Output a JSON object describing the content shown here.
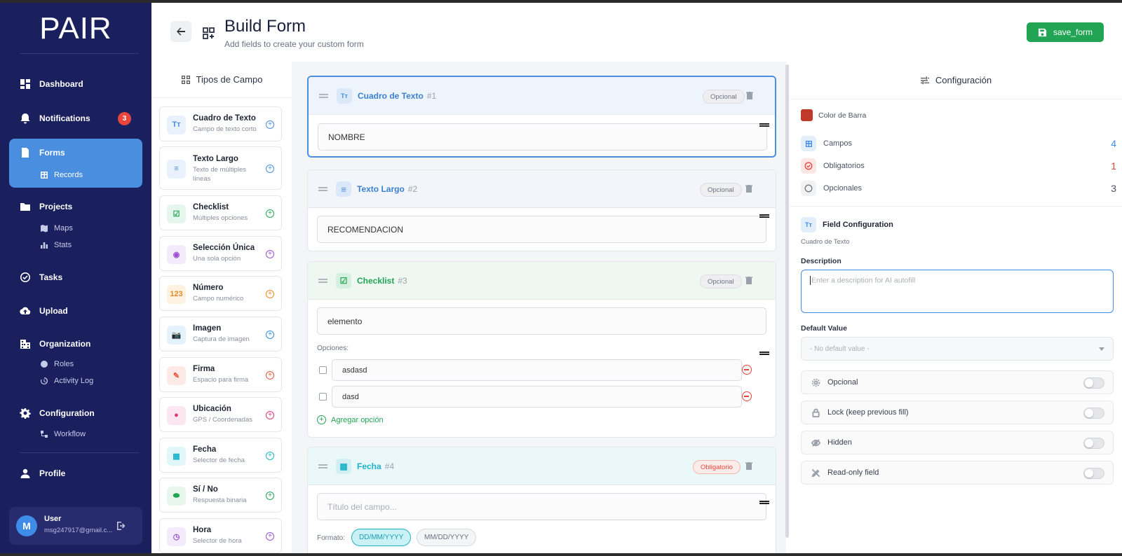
{
  "app": {
    "logo": "PAIR"
  },
  "sidebar": {
    "dashboard": "Dashboard",
    "notifications": "Notifications",
    "notifications_badge": "3",
    "forms": "Forms",
    "records": "Records",
    "projects": "Projects",
    "maps": "Maps",
    "stats": "Stats",
    "tasks": "Tasks",
    "upload": "Upload",
    "organization": "Organization",
    "roles": "Roles",
    "activity_log": "Activity Log",
    "configuration": "Configuration",
    "workflow": "Workflow",
    "profile": "Profile",
    "user": {
      "initial": "M",
      "name": "User",
      "email": "msg247917@gmail.c..."
    }
  },
  "header": {
    "title": "Build Form",
    "subtitle": "Add fields to create your custom form",
    "save_label": "save_form"
  },
  "field_types": {
    "title": "Tipos de Campo",
    "items": [
      {
        "name": "Cuadro de Texto",
        "desc": "Campo de texto corto",
        "icon": "Tт",
        "color": "#4a8ee0",
        "bg": "#e8f1fc"
      },
      {
        "name": "Texto Largo",
        "desc": "Texto de múltiples líneas",
        "icon": "≡",
        "color": "#4a8ee0",
        "bg": "#e8f1fc"
      },
      {
        "name": "Checklist",
        "desc": "Múltiples opciones",
        "icon": "☑",
        "color": "#22a455",
        "bg": "#e6f6ec"
      },
      {
        "name": "Selección Única",
        "desc": "Una sola opción",
        "icon": "◉",
        "color": "#9b4fd0",
        "bg": "#f3eafb"
      },
      {
        "name": "Número",
        "desc": "Campo numérico",
        "icon": "123",
        "color": "#e88a1e",
        "bg": "#fdf1e2"
      },
      {
        "name": "Imagen",
        "desc": "Captura de imagen",
        "icon": "📷",
        "color": "#2a8fd8",
        "bg": "#e4f2fb"
      },
      {
        "name": "Firma",
        "desc": "Espacio para firma",
        "icon": "✎",
        "color": "#e8553c",
        "bg": "#fde9e5"
      },
      {
        "name": "Ubicación",
        "desc": "GPS / Coordenadas",
        "icon": "●",
        "color": "#e0357a",
        "bg": "#fce6ef"
      },
      {
        "name": "Fecha",
        "desc": "Selector de fecha",
        "icon": "▦",
        "color": "#1db3c7",
        "bg": "#e1f6f8"
      },
      {
        "name": "Sí / No",
        "desc": "Respuesta binaria",
        "icon": "⬬",
        "color": "#22a455",
        "bg": "#e6f6ec"
      },
      {
        "name": "Hora",
        "desc": "Selector de hora",
        "icon": "◷",
        "color": "#9b4fd0",
        "bg": "#f3eafb"
      }
    ]
  },
  "canvas": {
    "cards": [
      {
        "name": "Cuadro de Texto",
        "num": "#1",
        "badge": "Opcional",
        "value": "NOMBRE"
      },
      {
        "name": "Texto Largo",
        "num": "#2",
        "badge": "Opcional",
        "value": "RECOMENDACION"
      },
      {
        "name": "Checklist",
        "num": "#3",
        "badge": "Opcional",
        "value": "elemento",
        "options_label": "Opciones:",
        "options": [
          "asdasd",
          "dasd"
        ],
        "add_option": "Agregar opción"
      },
      {
        "name": "Fecha",
        "num": "#4",
        "badge": "Obligatorio",
        "placeholder": "Título del campo...",
        "format_label": "Formato:",
        "formats": [
          "DD/MM/YYYY",
          "MM/DD/YYYY"
        ]
      }
    ]
  },
  "config": {
    "title": "Configuración",
    "bar_color_label": "Color de Barra",
    "bar_color": "#c0392b",
    "stats": [
      {
        "label": "Campos",
        "value": "4",
        "color": "#3f8ce8"
      },
      {
        "label": "Obligatorios",
        "value": "1",
        "color": "#e8453c"
      },
      {
        "label": "Opcionales",
        "value": "3",
        "color": "#4b5163"
      }
    ],
    "field_config_title": "Field Configuration",
    "field_config_sub": "Cuadro de Texto",
    "description_label": "Description",
    "description_placeholder": "Enter a description for AI autofill",
    "default_label": "Default Value",
    "default_value": "- No default value -",
    "toggles": [
      "Opcional",
      "Lock (keep previous fill)",
      "Hidden",
      "Read-only field"
    ]
  }
}
